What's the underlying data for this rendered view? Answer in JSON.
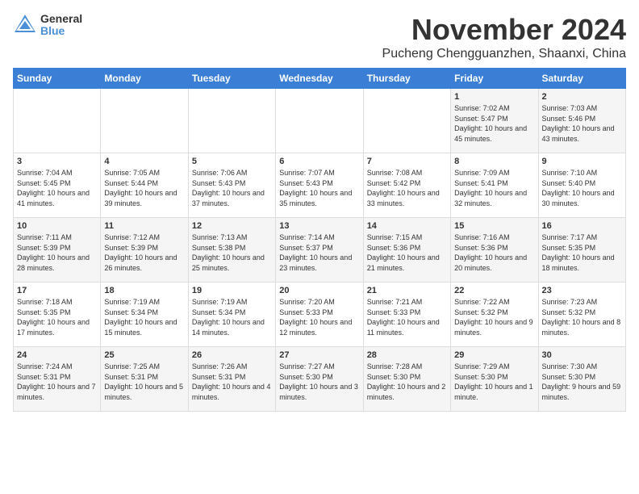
{
  "logo": {
    "general": "General",
    "blue": "Blue"
  },
  "header": {
    "month_year": "November 2024",
    "location": "Pucheng Chengguanzhen, Shaanxi, China"
  },
  "weekdays": [
    "Sunday",
    "Monday",
    "Tuesday",
    "Wednesday",
    "Thursday",
    "Friday",
    "Saturday"
  ],
  "weeks": [
    [
      {
        "day": "",
        "info": ""
      },
      {
        "day": "",
        "info": ""
      },
      {
        "day": "",
        "info": ""
      },
      {
        "day": "",
        "info": ""
      },
      {
        "day": "",
        "info": ""
      },
      {
        "day": "1",
        "info": "Sunrise: 7:02 AM\nSunset: 5:47 PM\nDaylight: 10 hours and 45 minutes."
      },
      {
        "day": "2",
        "info": "Sunrise: 7:03 AM\nSunset: 5:46 PM\nDaylight: 10 hours and 43 minutes."
      }
    ],
    [
      {
        "day": "3",
        "info": "Sunrise: 7:04 AM\nSunset: 5:45 PM\nDaylight: 10 hours and 41 minutes."
      },
      {
        "day": "4",
        "info": "Sunrise: 7:05 AM\nSunset: 5:44 PM\nDaylight: 10 hours and 39 minutes."
      },
      {
        "day": "5",
        "info": "Sunrise: 7:06 AM\nSunset: 5:43 PM\nDaylight: 10 hours and 37 minutes."
      },
      {
        "day": "6",
        "info": "Sunrise: 7:07 AM\nSunset: 5:43 PM\nDaylight: 10 hours and 35 minutes."
      },
      {
        "day": "7",
        "info": "Sunrise: 7:08 AM\nSunset: 5:42 PM\nDaylight: 10 hours and 33 minutes."
      },
      {
        "day": "8",
        "info": "Sunrise: 7:09 AM\nSunset: 5:41 PM\nDaylight: 10 hours and 32 minutes."
      },
      {
        "day": "9",
        "info": "Sunrise: 7:10 AM\nSunset: 5:40 PM\nDaylight: 10 hours and 30 minutes."
      }
    ],
    [
      {
        "day": "10",
        "info": "Sunrise: 7:11 AM\nSunset: 5:39 PM\nDaylight: 10 hours and 28 minutes."
      },
      {
        "day": "11",
        "info": "Sunrise: 7:12 AM\nSunset: 5:39 PM\nDaylight: 10 hours and 26 minutes."
      },
      {
        "day": "12",
        "info": "Sunrise: 7:13 AM\nSunset: 5:38 PM\nDaylight: 10 hours and 25 minutes."
      },
      {
        "day": "13",
        "info": "Sunrise: 7:14 AM\nSunset: 5:37 PM\nDaylight: 10 hours and 23 minutes."
      },
      {
        "day": "14",
        "info": "Sunrise: 7:15 AM\nSunset: 5:36 PM\nDaylight: 10 hours and 21 minutes."
      },
      {
        "day": "15",
        "info": "Sunrise: 7:16 AM\nSunset: 5:36 PM\nDaylight: 10 hours and 20 minutes."
      },
      {
        "day": "16",
        "info": "Sunrise: 7:17 AM\nSunset: 5:35 PM\nDaylight: 10 hours and 18 minutes."
      }
    ],
    [
      {
        "day": "17",
        "info": "Sunrise: 7:18 AM\nSunset: 5:35 PM\nDaylight: 10 hours and 17 minutes."
      },
      {
        "day": "18",
        "info": "Sunrise: 7:19 AM\nSunset: 5:34 PM\nDaylight: 10 hours and 15 minutes."
      },
      {
        "day": "19",
        "info": "Sunrise: 7:19 AM\nSunset: 5:34 PM\nDaylight: 10 hours and 14 minutes."
      },
      {
        "day": "20",
        "info": "Sunrise: 7:20 AM\nSunset: 5:33 PM\nDaylight: 10 hours and 12 minutes."
      },
      {
        "day": "21",
        "info": "Sunrise: 7:21 AM\nSunset: 5:33 PM\nDaylight: 10 hours and 11 minutes."
      },
      {
        "day": "22",
        "info": "Sunrise: 7:22 AM\nSunset: 5:32 PM\nDaylight: 10 hours and 9 minutes."
      },
      {
        "day": "23",
        "info": "Sunrise: 7:23 AM\nSunset: 5:32 PM\nDaylight: 10 hours and 8 minutes."
      }
    ],
    [
      {
        "day": "24",
        "info": "Sunrise: 7:24 AM\nSunset: 5:31 PM\nDaylight: 10 hours and 7 minutes."
      },
      {
        "day": "25",
        "info": "Sunrise: 7:25 AM\nSunset: 5:31 PM\nDaylight: 10 hours and 5 minutes."
      },
      {
        "day": "26",
        "info": "Sunrise: 7:26 AM\nSunset: 5:31 PM\nDaylight: 10 hours and 4 minutes."
      },
      {
        "day": "27",
        "info": "Sunrise: 7:27 AM\nSunset: 5:30 PM\nDaylight: 10 hours and 3 minutes."
      },
      {
        "day": "28",
        "info": "Sunrise: 7:28 AM\nSunset: 5:30 PM\nDaylight: 10 hours and 2 minutes."
      },
      {
        "day": "29",
        "info": "Sunrise: 7:29 AM\nSunset: 5:30 PM\nDaylight: 10 hours and 1 minute."
      },
      {
        "day": "30",
        "info": "Sunrise: 7:30 AM\nSunset: 5:30 PM\nDaylight: 9 hours and 59 minutes."
      }
    ]
  ]
}
